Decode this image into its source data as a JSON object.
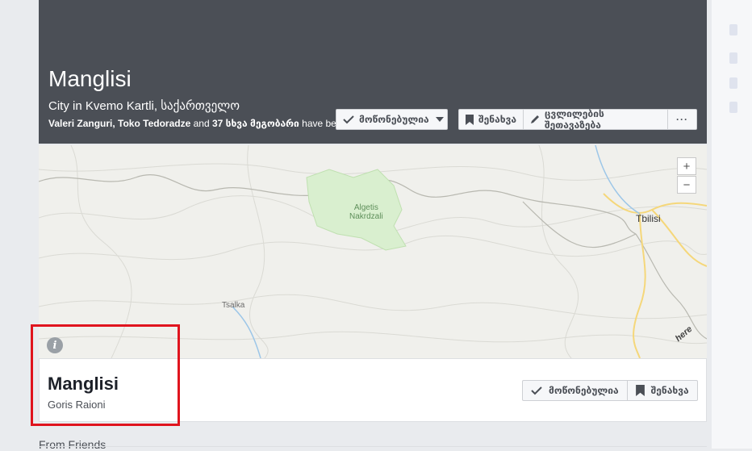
{
  "cover": {
    "title": "Manglisi",
    "subtitle": "City in Kvemo Kartli, საქართველო",
    "friends_names": "Valeri Zanguri, Toko Tedoradze",
    "friends_and": " and ",
    "friends_count": "37 სხვა მეგობარი",
    "friends_suffix": " have been here"
  },
  "actions": {
    "liked_label": "მოწონებულია",
    "save_label": "შენახვა",
    "suggest_edits_label": "ცვლილების შეთავაზება",
    "more_label": "···"
  },
  "map": {
    "labels": {
      "park": "Algetis\nNakrdzali",
      "city": "Tbilisi",
      "town": "Tsalka"
    },
    "zoom_in": "+",
    "zoom_out": "−",
    "attribution": "here",
    "park_color": "#d9efcf",
    "road_color": "#f5d77a",
    "river_color": "#9cc6e8"
  },
  "place_card": {
    "name": "Manglisi",
    "region": "Goris Raioni",
    "liked_label": "მოწონებულია",
    "save_label": "შენახვა"
  },
  "section": {
    "from_friends": "From Friends"
  }
}
